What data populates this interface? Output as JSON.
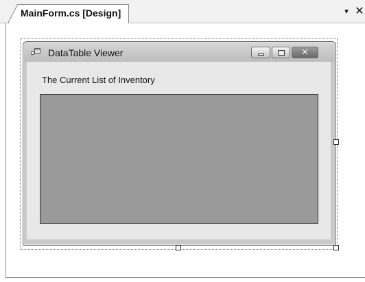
{
  "tab": {
    "title": "MainForm.cs [Design]",
    "dropdown_icon": "dropdown-arrow-icon",
    "close_icon": "close-icon"
  },
  "form": {
    "title": "DataTable Viewer",
    "icon": "form-icon",
    "caption_buttons": {
      "minimize_icon": "minimize-icon",
      "maximize_icon": "maximize-icon",
      "close_icon": "close-icon"
    },
    "label": "The Current List of Inventory",
    "grid_background": "#9a9a9a"
  },
  "glyphs": {
    "dropdown": "▾",
    "close": "✕",
    "close_caption": "✕"
  }
}
